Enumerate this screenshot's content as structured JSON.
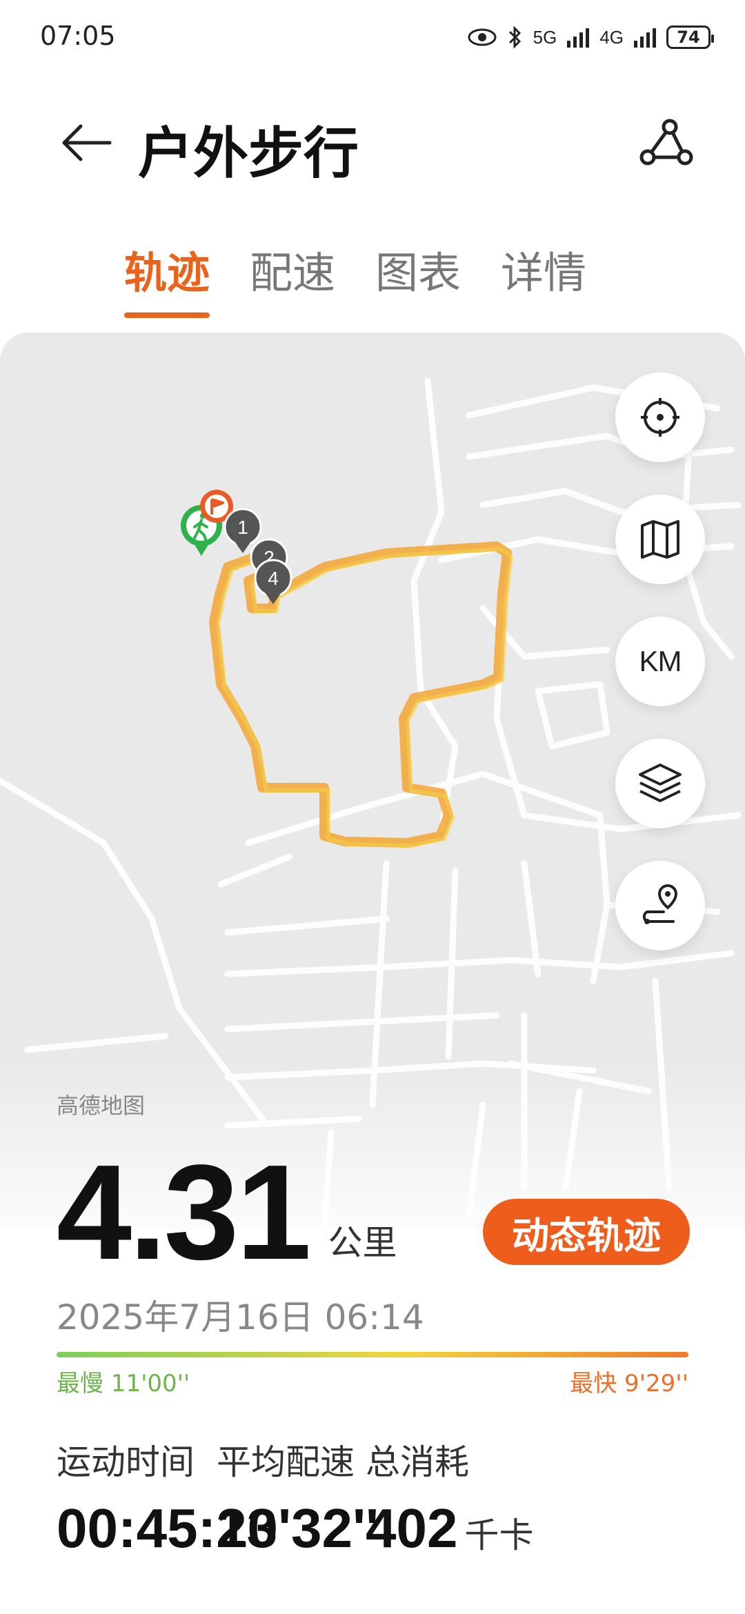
{
  "status": {
    "time": "07:05",
    "battery": "74",
    "net1": "5G",
    "net2": "4G"
  },
  "header": {
    "title": "户外步行"
  },
  "tabs": [
    "轨迹",
    "配速",
    "图表",
    "详情"
  ],
  "map": {
    "credit": "高德地图",
    "buttons": {
      "km": "KM"
    },
    "laps": [
      "1",
      "2",
      "4"
    ]
  },
  "stats": {
    "distance": "4.31",
    "distance_unit": "公里",
    "dynamic_track": "动态轨迹",
    "date": "2025年7月16日 06:14",
    "slowest": "最慢 11'00''",
    "fastest": "最快 9'29''",
    "metrics": [
      {
        "label": "运动时间",
        "value": "00:45:23",
        "unit": ""
      },
      {
        "label": "平均配速",
        "value": "10'32''",
        "unit": ""
      },
      {
        "label": "总消耗",
        "value": "402",
        "unit": "千卡"
      }
    ]
  }
}
